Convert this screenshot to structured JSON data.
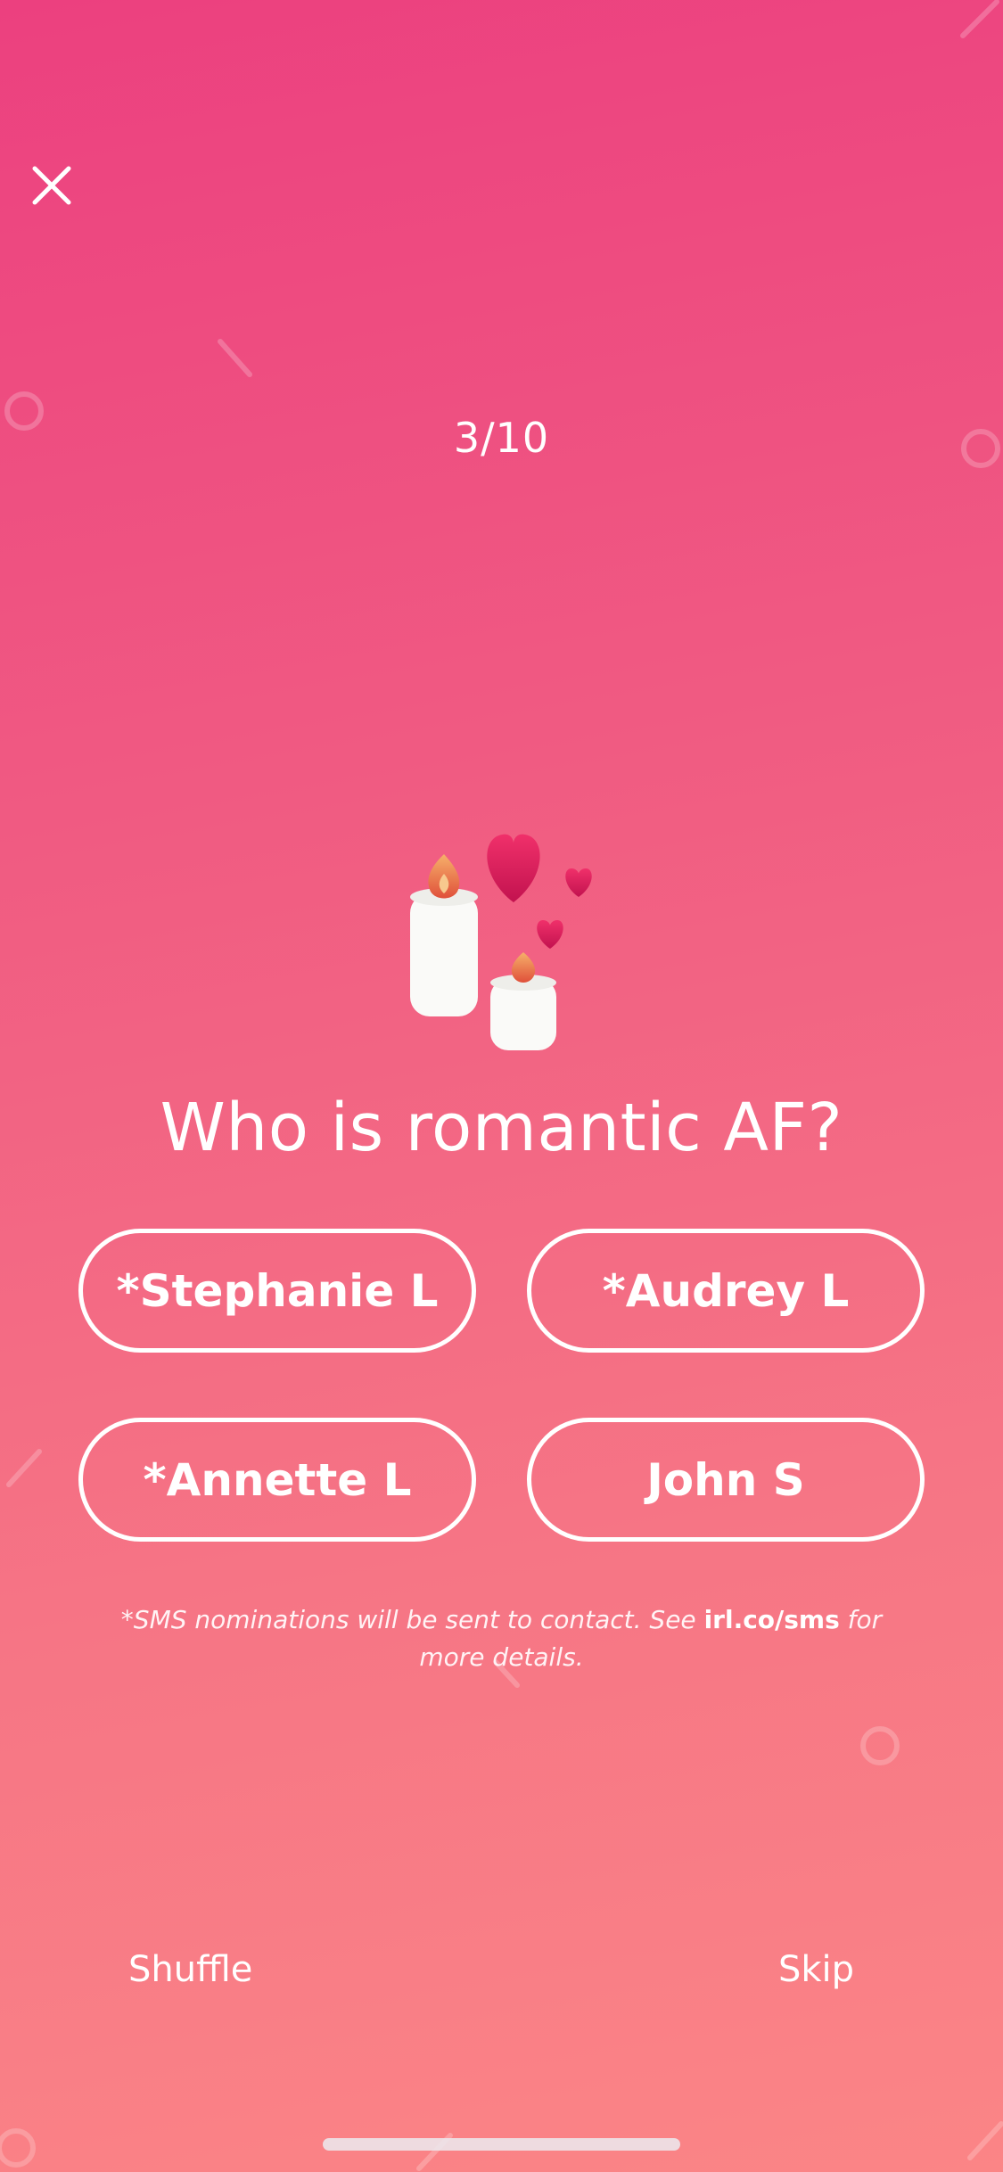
{
  "close": {
    "icon": "close-icon"
  },
  "progress": {
    "label": "3/10"
  },
  "illustration": {
    "icon": "candles-hearts-icon"
  },
  "question": {
    "text": "Who is romantic AF?"
  },
  "choices": [
    {
      "label": "*Stephanie L"
    },
    {
      "label": "*Audrey L"
    },
    {
      "label": "*Annette L"
    },
    {
      "label": "John S"
    }
  ],
  "sms_note": {
    "prefix": "*SMS nominations will be sent to contact. See ",
    "link": "irl.co/sms",
    "suffix": " for more details."
  },
  "actions": {
    "shuffle": "Shuffle",
    "skip": "Skip"
  },
  "colors": {
    "gradient_top": "#ec407f",
    "gradient_bottom": "#fb8586",
    "text": "#ffffff"
  }
}
